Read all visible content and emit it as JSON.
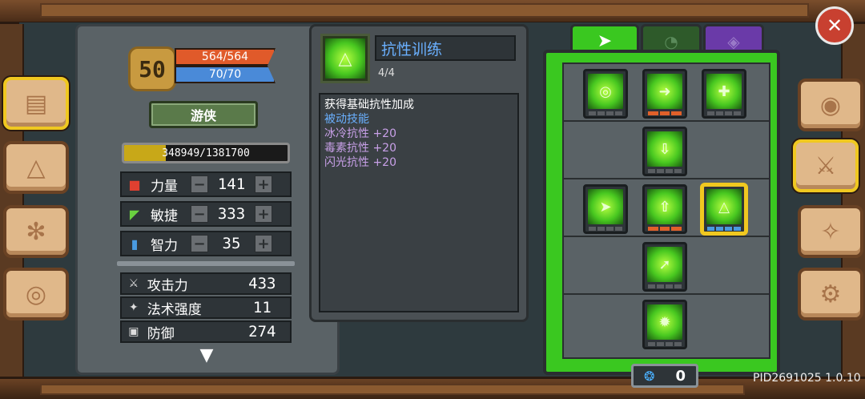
{
  "character": {
    "level": "50",
    "hp": "564/564",
    "mp": "70/70",
    "class_name": "游侠",
    "xp_text": "348949/1381700",
    "xp_fraction": 0.253
  },
  "attributes": [
    {
      "icon": "strength-icon",
      "label": "力量",
      "value": "141",
      "color": "#e04030"
    },
    {
      "icon": "agility-icon",
      "label": "敏捷",
      "value": "333",
      "color": "#6ad040"
    },
    {
      "icon": "intelligence-icon",
      "label": "智力",
      "value": "35",
      "color": "#4a9ae0"
    }
  ],
  "stats": [
    {
      "icon": "sword-icon",
      "label": "攻击力",
      "value": "433"
    },
    {
      "icon": "wand-icon",
      "label": "法术强度",
      "value": "11"
    },
    {
      "icon": "shield-icon",
      "label": "防御",
      "value": "274"
    }
  ],
  "skill": {
    "name": "抗性训练",
    "level": "4/4",
    "desc_lines": [
      {
        "text": "获得基础抗性加成",
        "color": "#ffffff"
      },
      {
        "text": "被动技能",
        "color": "#6ab0ff"
      },
      {
        "text": "冰冷抗性 +20",
        "color": "#c8a0e8"
      },
      {
        "text": "毒素抗性 +20",
        "color": "#c8a0e8"
      },
      {
        "text": "闪光抗性 +20",
        "color": "#c8a0e8"
      }
    ]
  },
  "skill_points": "0",
  "version": "PID2691025 1.0.10",
  "colors": {
    "accent_green": "#3ac820",
    "selected_gold": "#f0c820",
    "hp_orange": "#e05a2a",
    "mp_blue": "#4a8ad8"
  }
}
